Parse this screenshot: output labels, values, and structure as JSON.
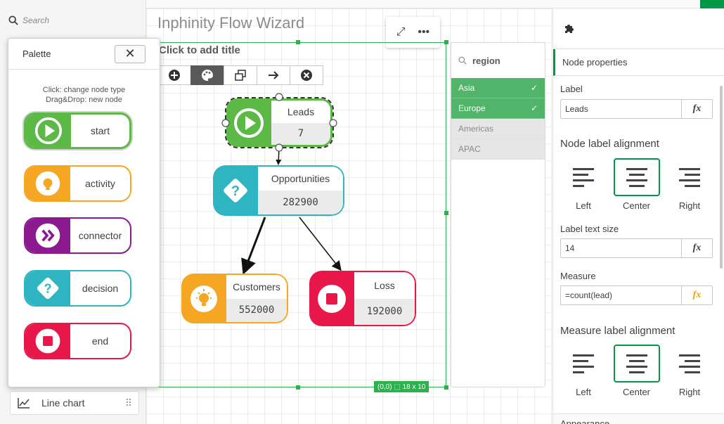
{
  "app": {
    "sheet_title": "Inphinity Flow Wizard"
  },
  "assets": {
    "search_placeholder": "Search",
    "line_chart_label": "Line chart"
  },
  "object": {
    "title_placeholder": "Click to add title",
    "status": "(0,0) ⬚ 18 x 10",
    "nodes": [
      {
        "id": "leads",
        "label": "Leads",
        "value": "7",
        "type": "start",
        "color": "#5cb946"
      },
      {
        "id": "opportunities",
        "label": "Opportunities",
        "value": "282900",
        "type": "decision",
        "color": "#2fb5c1"
      },
      {
        "id": "customers",
        "label": "Customers",
        "value": "552000",
        "type": "activity",
        "color": "#f5a623"
      },
      {
        "id": "loss",
        "label": "Loss",
        "value": "192000",
        "type": "end",
        "color": "#e8174a"
      }
    ]
  },
  "filter": {
    "field": "region",
    "values": [
      {
        "label": "Asia",
        "state": "selected"
      },
      {
        "label": "Europe",
        "state": "selected"
      },
      {
        "label": "Americas",
        "state": "alternative"
      },
      {
        "label": "APAC",
        "state": "alternative"
      }
    ]
  },
  "palette": {
    "title": "Palette",
    "close": "✕",
    "hint_line1": "Click: change node type",
    "hint_line2": "Drag&Drop: new node",
    "items": [
      {
        "label": "start",
        "color": "#5cb946"
      },
      {
        "label": "activity",
        "color": "#f5a623"
      },
      {
        "label": "connector",
        "color": "#8b1a8f"
      },
      {
        "label": "decision",
        "color": "#2fb5c1"
      },
      {
        "label": "end",
        "color": "#e8174a"
      }
    ]
  },
  "properties": {
    "section": "Node properties",
    "label_title": "Label",
    "label_value": "Leads",
    "node_align_title": "Node label alignment",
    "label_size_title": "Label text size",
    "label_size_value": "14",
    "measure_title": "Measure",
    "measure_value": "=count(lead)",
    "measure_align_title": "Measure label alignment",
    "align_left": "Left",
    "align_center": "Center",
    "align_right": "Right",
    "fx": "fx",
    "appearance": "Appearance"
  },
  "colors": {
    "accent": "#009845",
    "selection": "#52b36b",
    "frame": "#2bb24c"
  }
}
